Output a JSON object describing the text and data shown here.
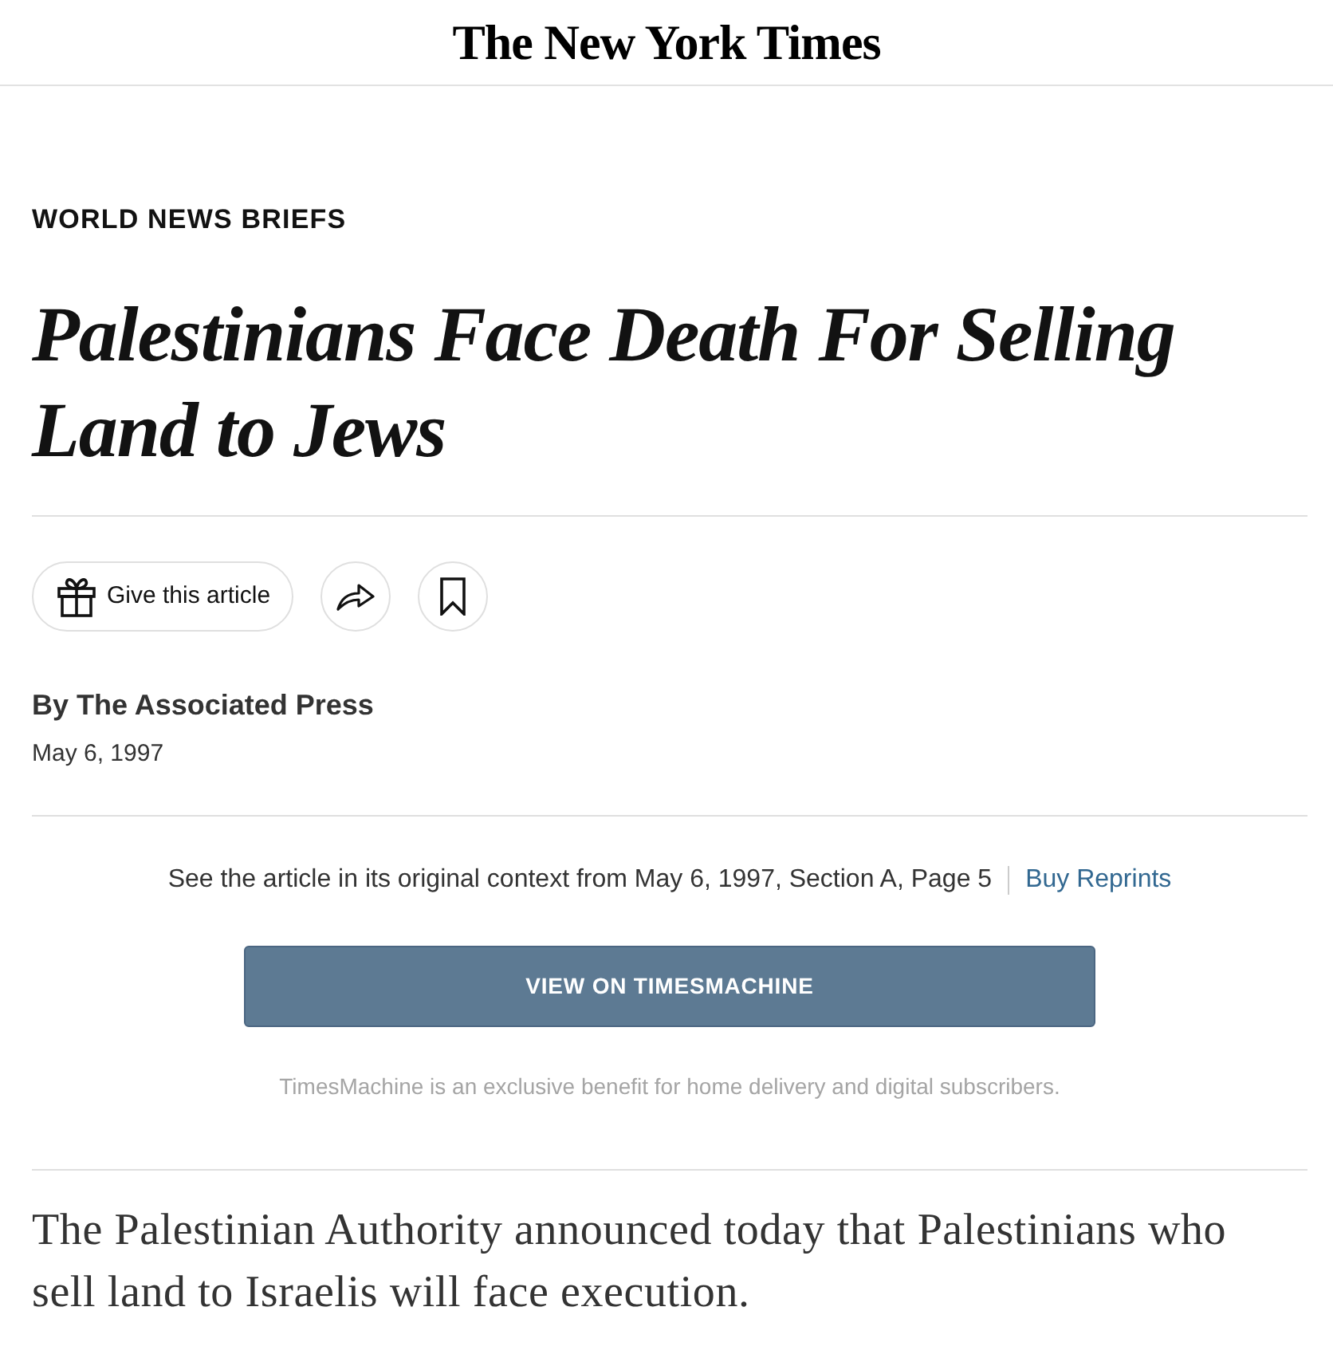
{
  "masthead": {
    "logo": "The New York Times"
  },
  "article": {
    "kicker": "WORLD NEWS BRIEFS",
    "headline": "Palestinians Face Death For Selling Land to Jews"
  },
  "actions": [
    {
      "kind": "gift",
      "label": "Give this article"
    },
    {
      "kind": "share"
    },
    {
      "kind": "bookmark"
    }
  ],
  "byline": {
    "author": "By The Associated Press",
    "date": "May 6, 1997"
  },
  "print_context": {
    "text": "See the article in its original context from May 6, 1997, Section A, Page 5",
    "link": "Buy Reprints"
  },
  "timesmachine": {
    "button": "VIEW ON TIMESMACHINE",
    "note": "TimesMachine is an exclusive benefit for home delivery and digital subscribers."
  },
  "body": [
    "The Palestinian Authority announced today that Palestinians who sell land to Israelis will face execution."
  ]
}
